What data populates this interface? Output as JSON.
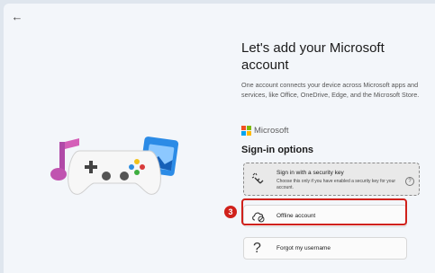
{
  "nav": {
    "back_icon": "back-arrow-icon",
    "back_glyph": "←"
  },
  "page": {
    "title": "Let's add your Microsoft account",
    "description": "One account connects your device across Microsoft apps and services, like Office, OneDrive, Edge, and the Microsoft Store.",
    "brand": "Microsoft",
    "brand_colors": [
      "#f25022",
      "#7fba00",
      "#00a4ef",
      "#ffb900"
    ],
    "section_title": "Sign-in options"
  },
  "options": [
    {
      "title": "Sign in with a security key",
      "subtitle": "Choose this only if you have enabled a security key for your account.",
      "icon": "security-key-icon",
      "help_glyph": "?"
    },
    {
      "title": "Offline account",
      "icon": "offline-cloud-icon"
    },
    {
      "title": "Forgot my username",
      "icon": "question-icon",
      "glyph": "?"
    }
  ],
  "annotation": {
    "step": "3",
    "color": "#d0211b"
  }
}
